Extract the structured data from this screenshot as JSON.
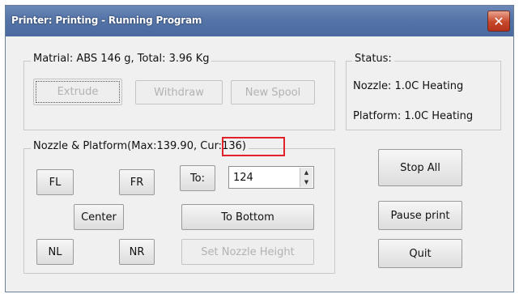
{
  "window": {
    "title": "Printer: Printing - Running Program",
    "close_glyph": "✕"
  },
  "material_group": {
    "label": "Matrial: ABS 146 g,  Total: 3.96 Kg",
    "buttons": {
      "extrude": "Extrude",
      "withdraw": "Withdraw",
      "new_spool": "New Spool"
    }
  },
  "status_group": {
    "label": "Status:",
    "nozzle": "Nozzle: 1.0C Heating",
    "platform": "Platform: 1.0C Heating"
  },
  "nozzle_group": {
    "label_prefix": "Nozzle & Platform(Max:139.90, ",
    "label_cur": "Cur:136)",
    "buttons": {
      "fl": "FL",
      "fr": "FR",
      "to": "To:",
      "center": "Center",
      "to_bottom": "To Bottom",
      "nl": "NL",
      "nr": "NR",
      "set_nozzle_height": "Set Nozzle Height"
    },
    "height_input_value": "124",
    "spin_up_glyph": "▲",
    "spin_down_glyph": "▼"
  },
  "actions": {
    "stop_all": "Stop All",
    "pause_print": "Pause print",
    "quit": "Quit"
  },
  "colors": {
    "title_bar": "#5574a8",
    "highlight": "#e2222a",
    "close_button": "#c7472b"
  }
}
